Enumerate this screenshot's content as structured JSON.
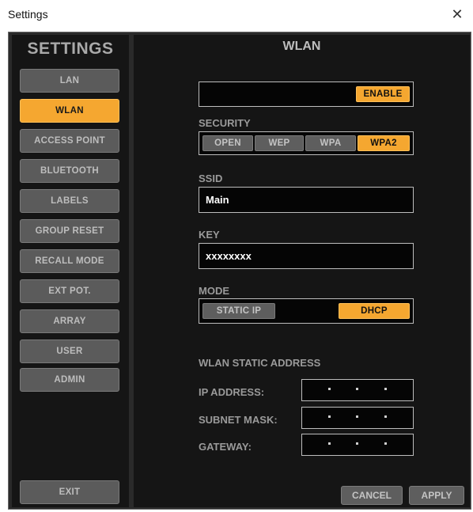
{
  "window": {
    "title": "Settings",
    "close_glyph": "✕"
  },
  "sidebar": {
    "header": "SETTINGS",
    "items": [
      {
        "label": "LAN",
        "active": false
      },
      {
        "label": "WLAN",
        "active": true
      },
      {
        "label": "ACCESS POINT",
        "active": false
      },
      {
        "label": "BLUETOOTH",
        "active": false
      },
      {
        "label": "LABELS",
        "active": false
      },
      {
        "label": "GROUP RESET",
        "active": false
      },
      {
        "label": "RECALL MODE",
        "active": false
      },
      {
        "label": "EXT POT.",
        "active": false
      },
      {
        "label": "ARRAY",
        "active": false
      },
      {
        "label": "USER",
        "active": false
      },
      {
        "label": "ADMIN",
        "active": false
      }
    ],
    "exit_label": "EXIT"
  },
  "main": {
    "header": "WLAN",
    "enable_label": "ENABLE",
    "security": {
      "label": "SECURITY",
      "options": [
        "OPEN",
        "WEP",
        "WPA",
        "WPA2"
      ],
      "selected": "WPA2"
    },
    "ssid": {
      "label": "SSID",
      "value": "Main"
    },
    "key": {
      "label": "KEY",
      "value": "xxxxxxxx"
    },
    "mode": {
      "label": "MODE",
      "options": [
        "STATIC IP",
        "DHCP"
      ],
      "selected": "DHCP"
    },
    "static_address": {
      "title": "WLAN STATIC ADDRESS",
      "ip_label": "IP ADDRESS:",
      "subnet_label": "SUBNET MASK:",
      "gateway_label": "GATEWAY:"
    },
    "cancel_label": "CANCEL",
    "apply_label": "APPLY"
  },
  "colors": {
    "accent": "#f5a730",
    "button_gray": "#5b5b5b",
    "panel": "#151515",
    "frame": "#2a2a2a"
  }
}
